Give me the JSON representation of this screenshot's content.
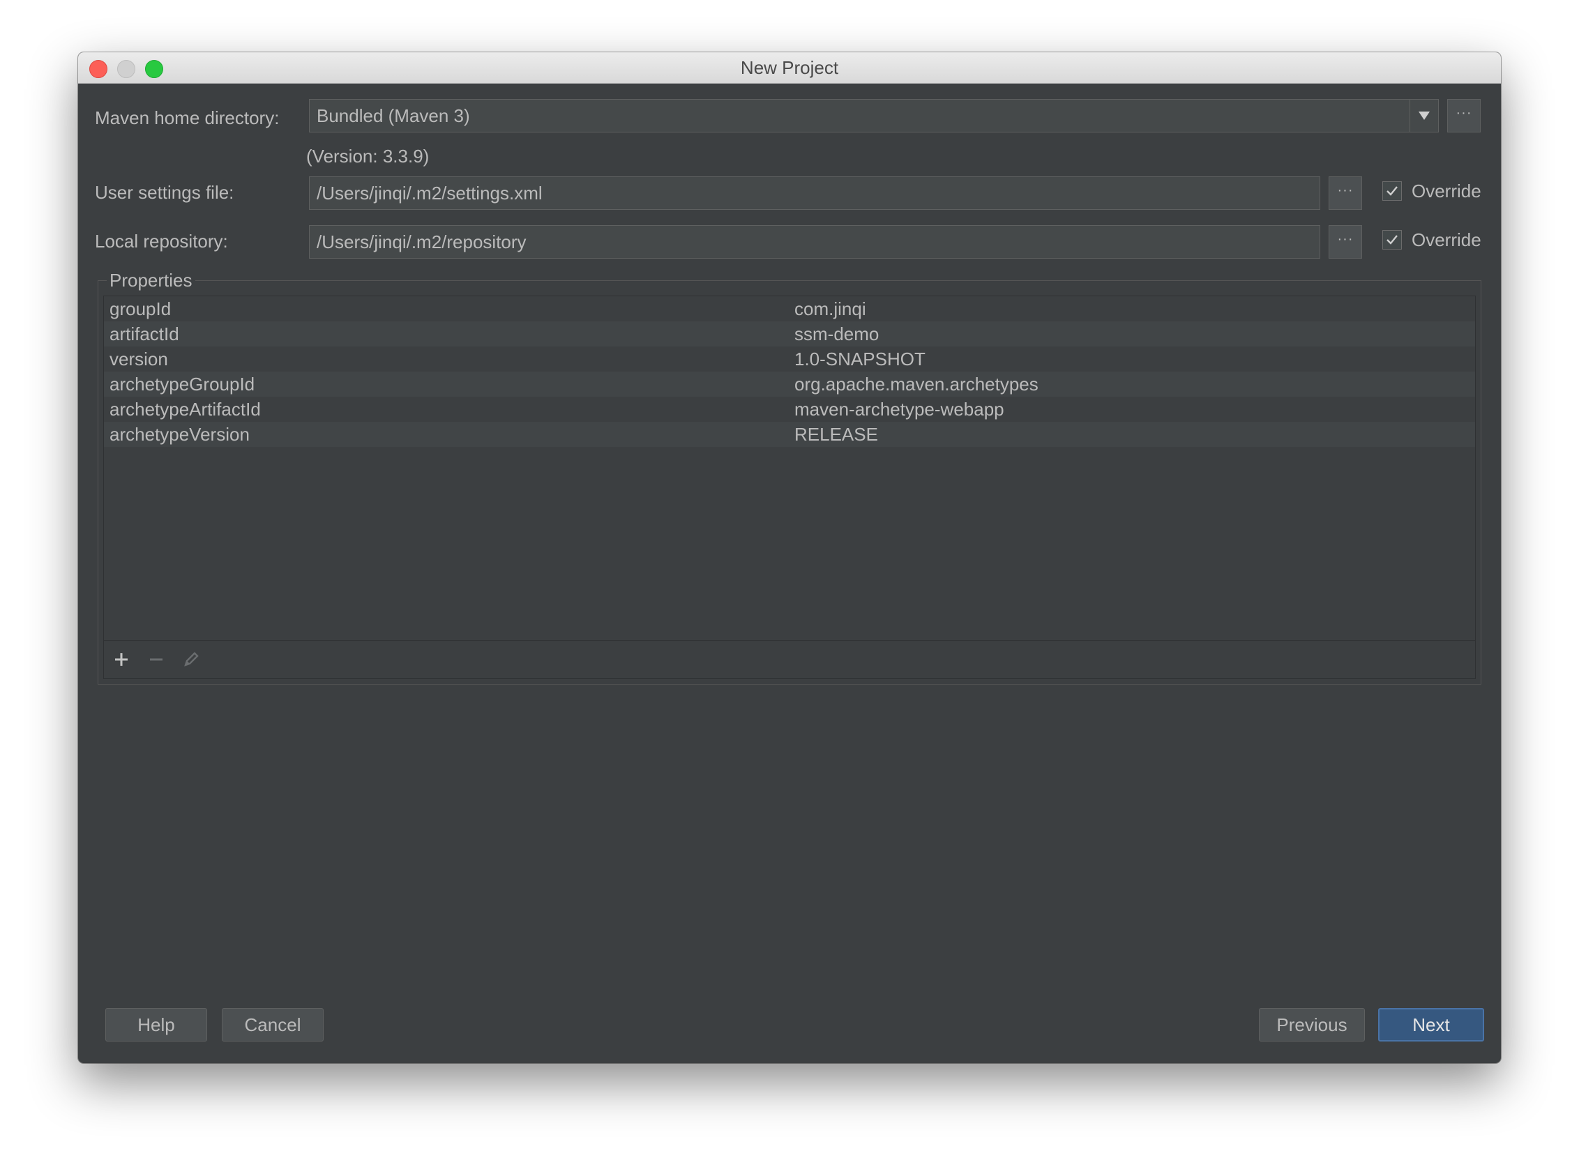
{
  "window": {
    "title": "New Project"
  },
  "form": {
    "maven_home_label": "Maven home directory:",
    "maven_home_value": "Bundled (Maven 3)",
    "version_text": "(Version: 3.3.9)",
    "user_settings_label": "User settings file:",
    "user_settings_value": "/Users/jinqi/.m2/settings.xml",
    "local_repo_label": "Local repository:",
    "local_repo_value": "/Users/jinqi/.m2/repository",
    "browse_label": "···",
    "override_label": "Override",
    "user_settings_override": true,
    "local_repo_override": true
  },
  "properties": {
    "title": "Properties",
    "rows": [
      {
        "key": "groupId",
        "value": "com.jinqi"
      },
      {
        "key": "artifactId",
        "value": "ssm-demo"
      },
      {
        "key": "version",
        "value": "1.0-SNAPSHOT"
      },
      {
        "key": "archetypeGroupId",
        "value": "org.apache.maven.archetypes"
      },
      {
        "key": "archetypeArtifactId",
        "value": "maven-archetype-webapp"
      },
      {
        "key": "archetypeVersion",
        "value": "RELEASE"
      }
    ],
    "toolbar_icons": [
      "plus-icon",
      "minus-icon",
      "pencil-icon"
    ]
  },
  "buttons": {
    "help": "Help",
    "cancel": "Cancel",
    "previous": "Previous",
    "next": "Next"
  },
  "colors": {
    "background": "#3c3f41",
    "primary_button": "#365880",
    "text": "#bbbbbb"
  }
}
